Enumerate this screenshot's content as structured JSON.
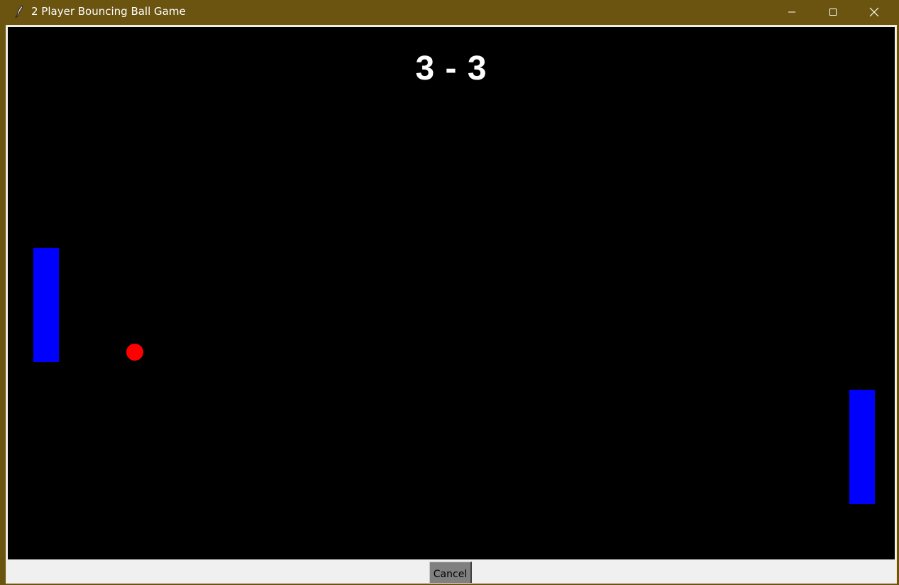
{
  "window": {
    "title": "2 Player Bouncing Ball Game",
    "titlebar_color": "#6b5310",
    "icons": {
      "app": "feather-icon",
      "minimize": "minimize-icon",
      "maximize": "maximize-icon",
      "close": "close-icon"
    }
  },
  "game": {
    "score": "3 - 3",
    "canvas_color": "#000000",
    "paddle_color": "#0000ff",
    "ball_color": "#ff0000"
  },
  "footer": {
    "cancel_label": "Cancel"
  }
}
